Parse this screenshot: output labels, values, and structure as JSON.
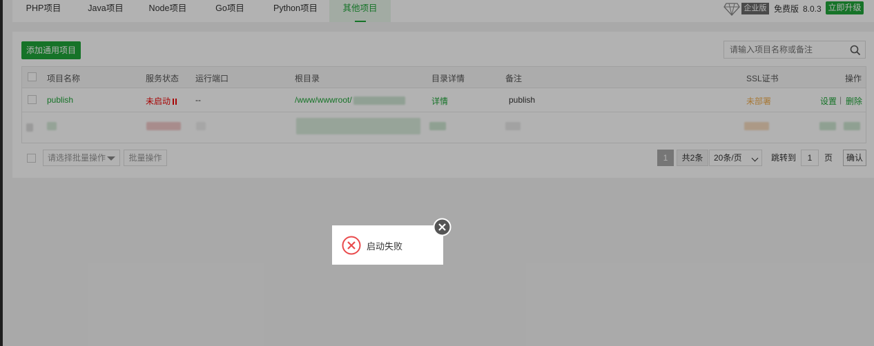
{
  "tabs": [
    {
      "label": "PHP项目"
    },
    {
      "label": "Java项目"
    },
    {
      "label": "Node项目"
    },
    {
      "label": "Go项目"
    },
    {
      "label": "Python项目"
    },
    {
      "label": "其他项目",
      "active": true
    }
  ],
  "version": {
    "enterprise_label": "企业版",
    "free_label": "免费版",
    "number": "8.0.3",
    "upgrade_label": "立即升级"
  },
  "toolbar": {
    "add_label": "添加通用项目",
    "search_placeholder": "请输入项目名称或备注"
  },
  "table": {
    "headers": {
      "name": "项目名称",
      "status": "服务状态",
      "port": "运行端口",
      "root": "根目录",
      "detail": "目录详情",
      "remark": "备注",
      "ssl": "SSL证书",
      "action": "操作"
    },
    "rows": [
      {
        "name": "publish",
        "status": "未启动",
        "port": "--",
        "root": "/www/wwwroot/",
        "detail": "详情",
        "remark": "publish",
        "ssl": "未部署",
        "action_settings": "设置",
        "action_separator": "|",
        "action_delete": "删除"
      }
    ]
  },
  "footer": {
    "batch_placeholder": "请选择批量操作",
    "batch_button": "批量操作",
    "page_current": "1",
    "page_total": "共2条",
    "page_size": "20条/页",
    "jump_label": "跳转到",
    "jump_value": "1",
    "page_unit": "页",
    "confirm_label": "确认"
  },
  "toast": {
    "message": "启动失败"
  },
  "colors": {
    "accent": "#20a53a",
    "error": "#ef0808",
    "warning": "#f0ad4e"
  }
}
